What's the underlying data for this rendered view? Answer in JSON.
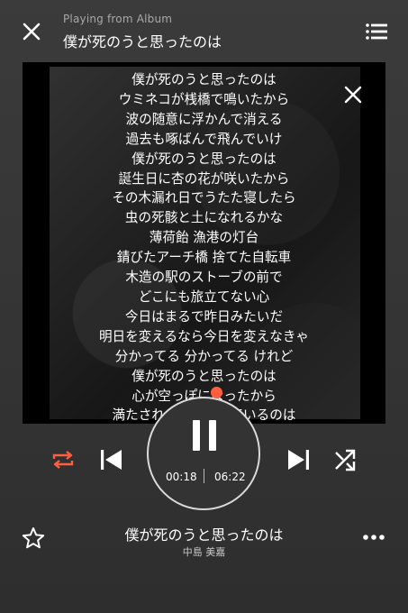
{
  "header": {
    "subtitle": "Playing from Album",
    "title": "僕が死のうと思ったのは"
  },
  "lyrics": [
    "僕が死のうと思ったのは",
    "ウミネコが桟橋で鳴いたから",
    "波の随意に浮かんで消える",
    "過去も啄ばんで飛んでいけ",
    "僕が死のうと思ったのは",
    "誕生日に杏の花が咲いたから",
    "その木漏れ日でうたた寝したら",
    "虫の死骸と土になれるかな",
    "薄荷飴 漁港の灯台",
    "錆びたアーチ橋 捨てた自転車",
    "木造の駅のストーブの前で",
    "どこにも旅立てない心",
    "今日はまるで昨日みたいだ",
    "明日を変えるなら今日を変えなきゃ",
    "分かってる 分かってる けれど",
    "僕が死のうと思ったのは",
    "心が空っぽになったから",
    "満たされないと泣いているのは"
  ],
  "player": {
    "elapsed": "00:18",
    "duration": "06:22",
    "progress_fraction": 0.047
  },
  "track": {
    "title": "僕が死のうと思ったのは",
    "artist": "中島 美嘉"
  },
  "colors": {
    "accent": "#ff5f3f",
    "background": "#363636"
  },
  "icons": [
    "close-icon",
    "queue-icon",
    "repeat-icon",
    "previous-icon",
    "pause-icon",
    "next-icon",
    "shuffle-icon",
    "star-icon",
    "more-icon"
  ]
}
